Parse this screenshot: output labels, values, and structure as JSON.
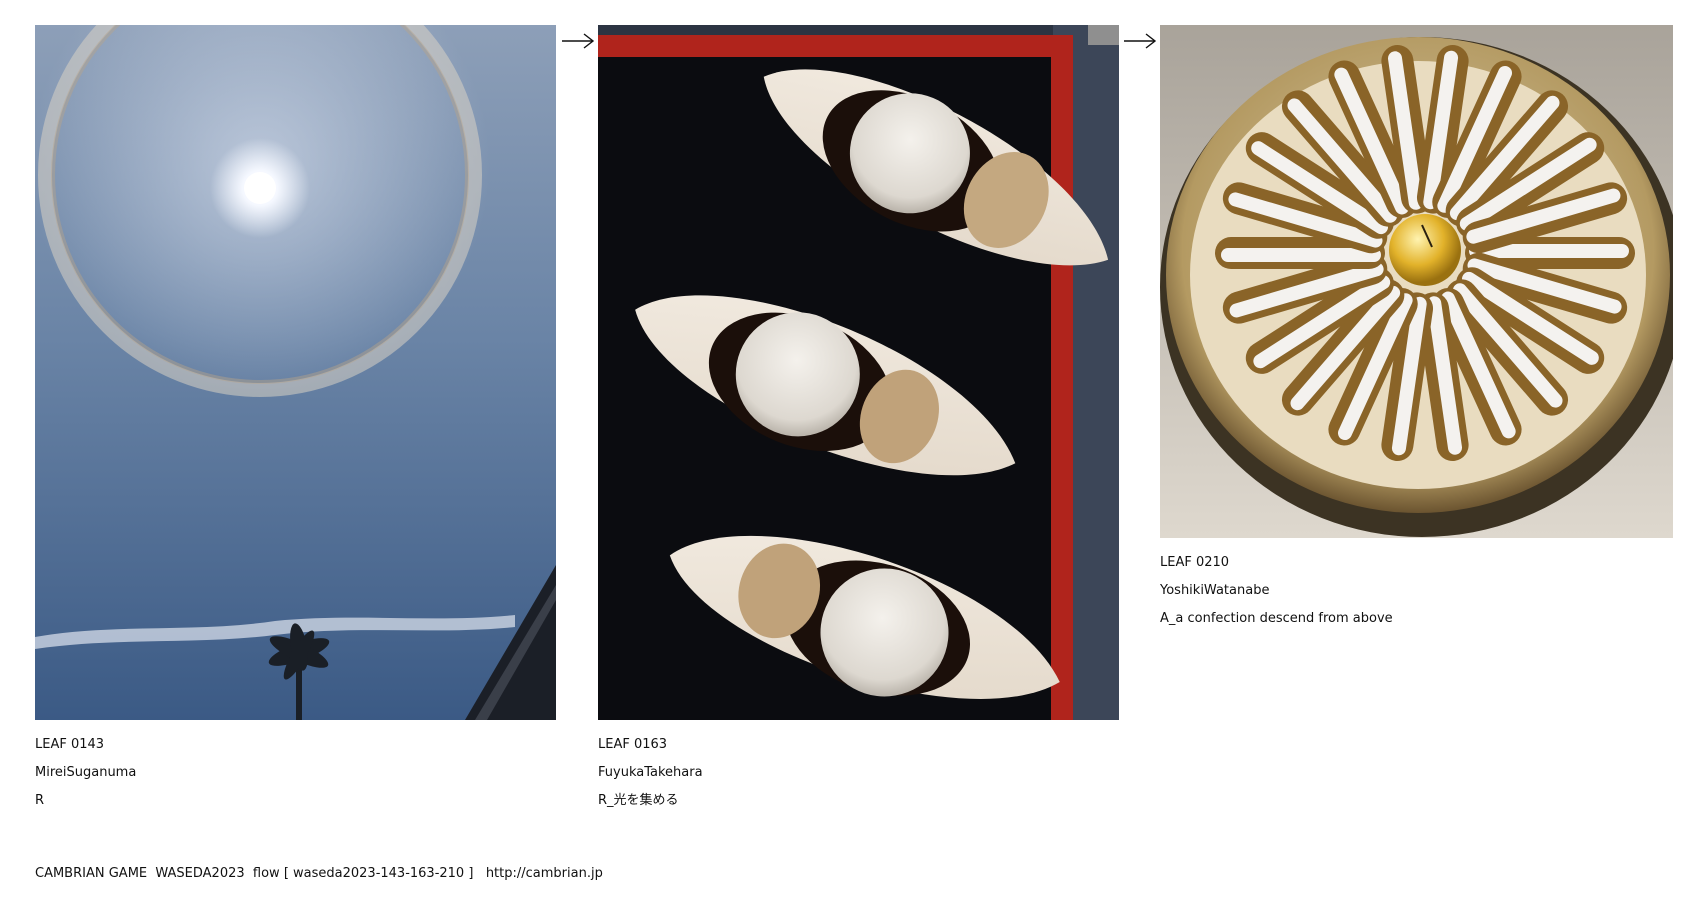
{
  "leaves": [
    {
      "id": "LEAF 0143",
      "author": "MireiSuganuma",
      "title": "R",
      "image": "sun-halo-sky-photo"
    },
    {
      "id": "LEAF 0163",
      "author": "FuyukaTakehara",
      "title": "R_光を集める",
      "image": "mochi-dessert-photo"
    },
    {
      "id": "LEAF 0210",
      "author": "YoshikiWatanabe",
      "title": "A_a confection descend from above",
      "image": "radial-confection-photo"
    }
  ],
  "arrows": [
    "right-arrow-icon",
    "right-arrow-icon"
  ],
  "footer": {
    "text": "CAMBRIAN GAME  WASEDA2023  flow [ waseda2023-143-163-210 ]   ",
    "link": "http://cambrian.jp"
  }
}
